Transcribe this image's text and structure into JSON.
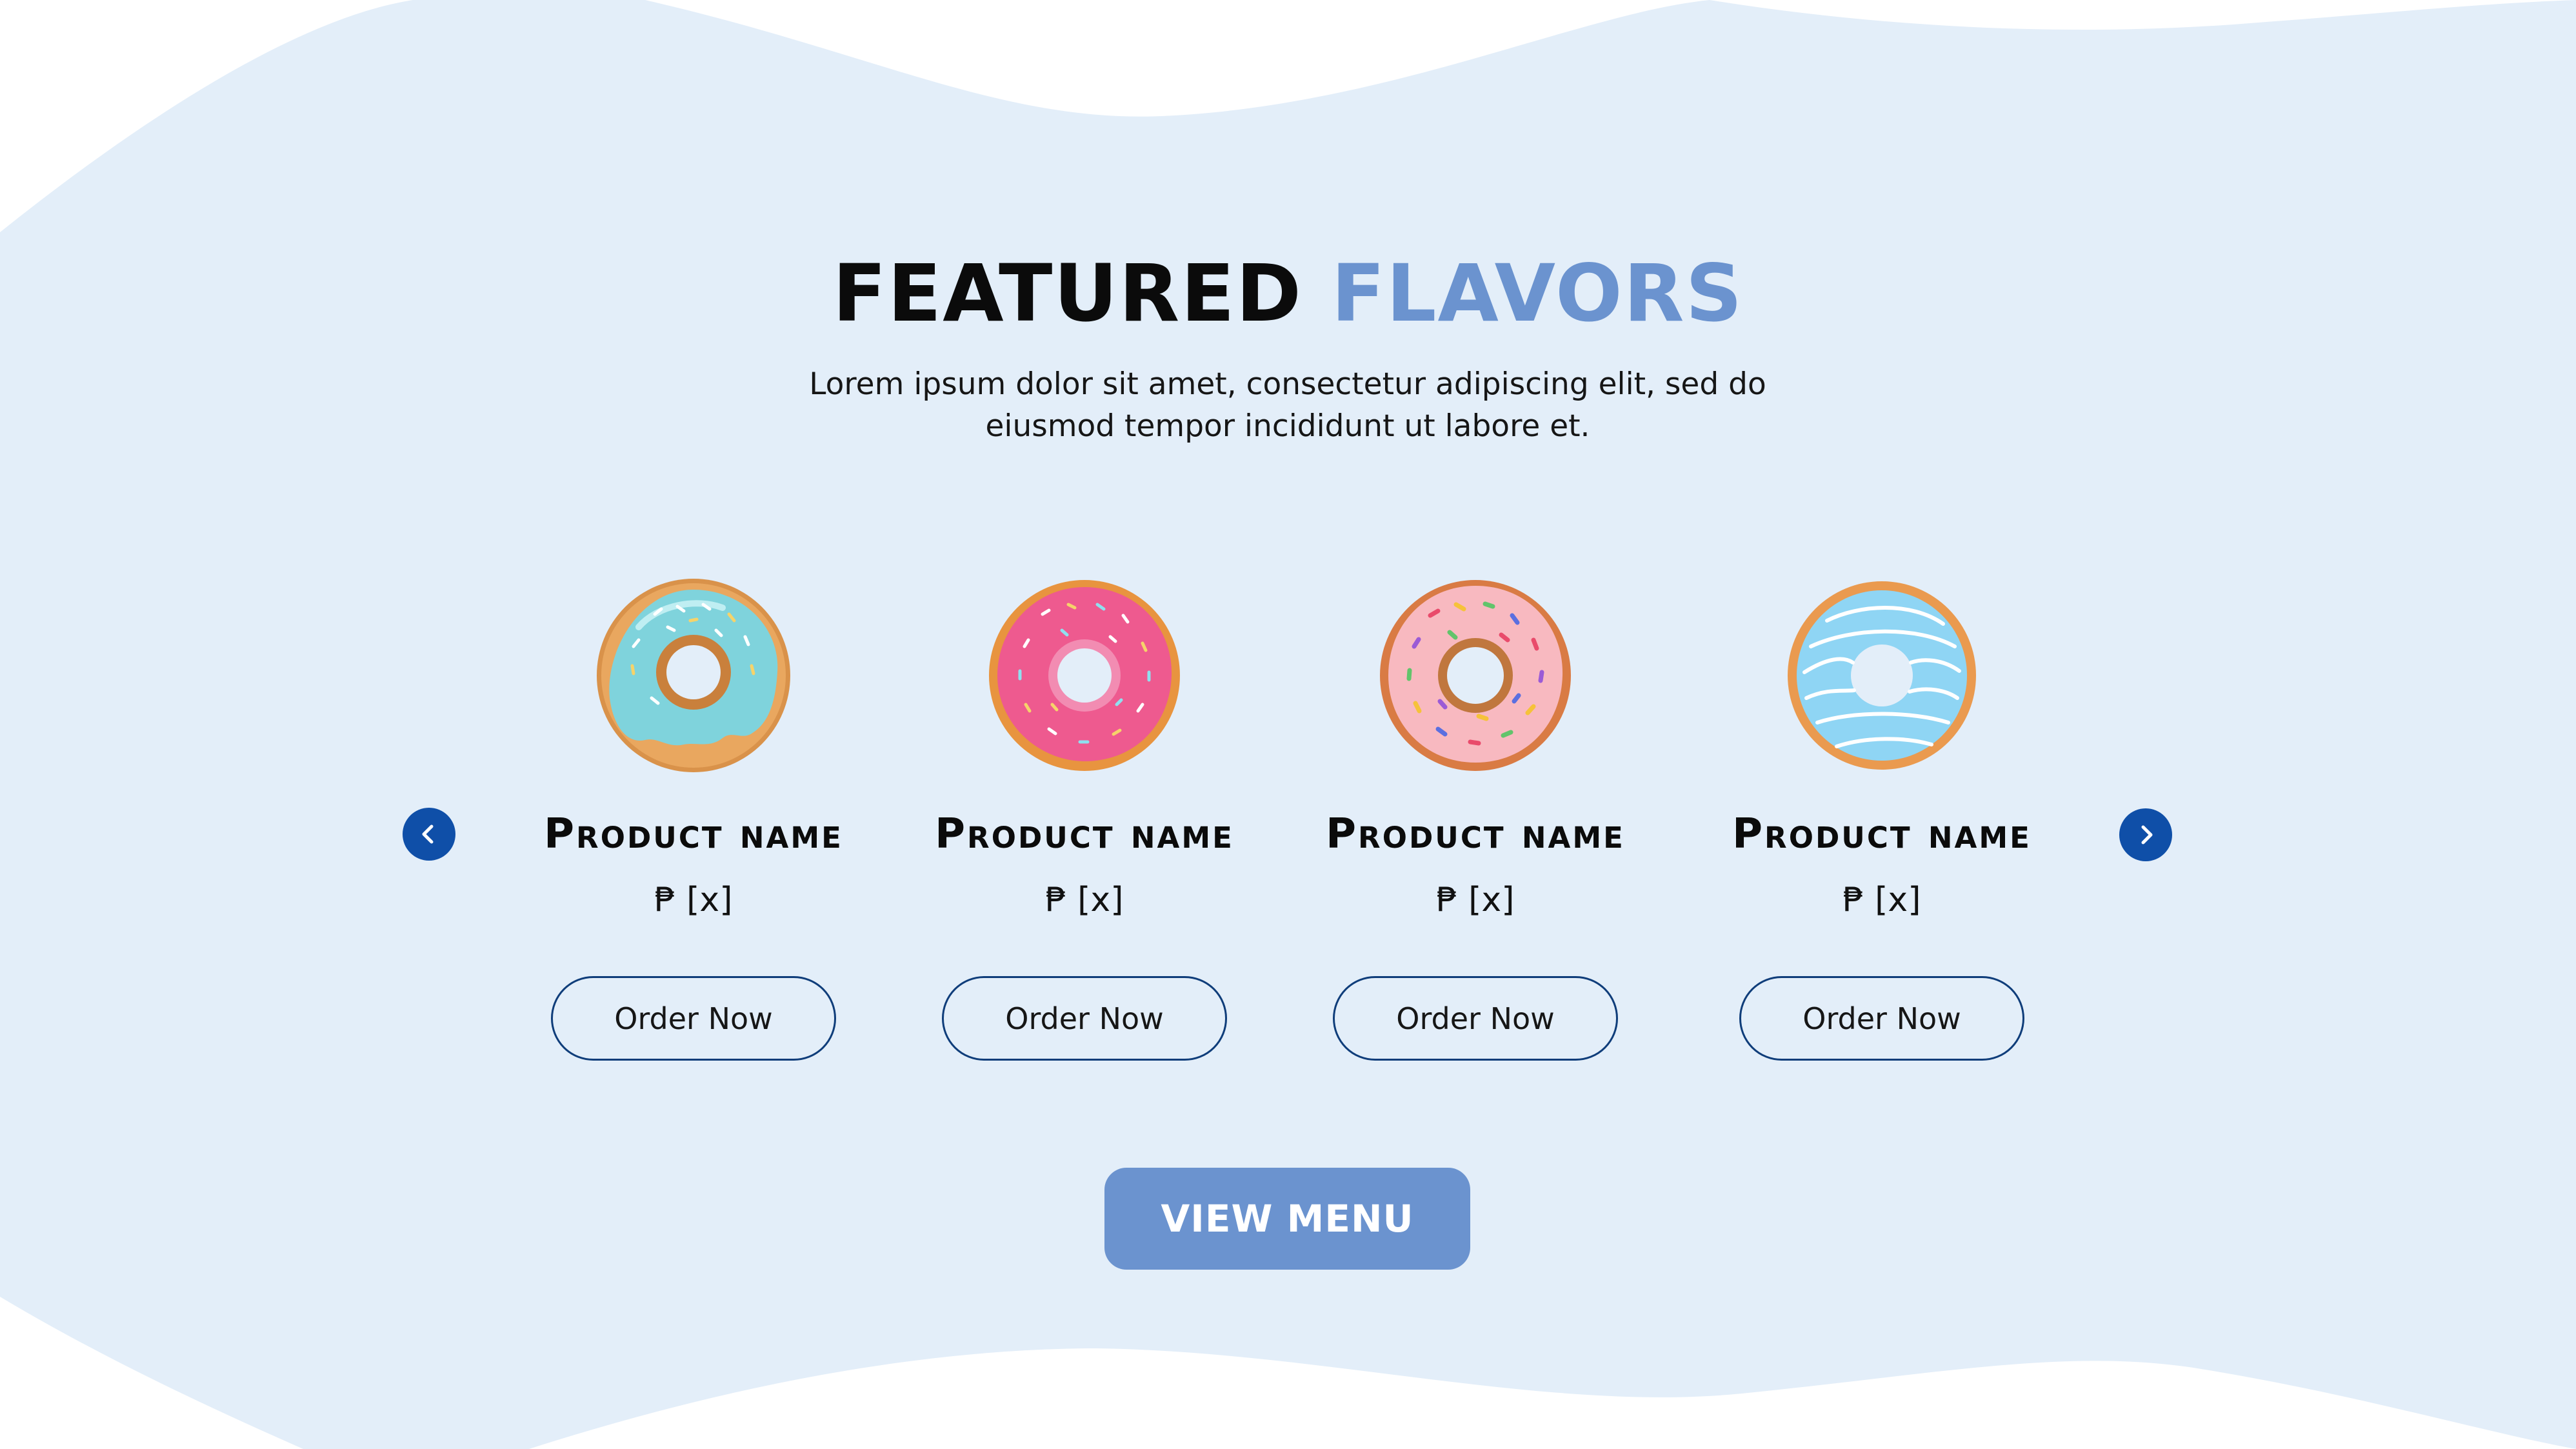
{
  "colors": {
    "background_wave": "#e3eef9",
    "page_background": "#ffffff",
    "accent": "#6b93cf",
    "arrow": "#0f4fa8",
    "button_border": "#0f3d7a"
  },
  "header": {
    "title_part1": "FEATURED",
    "title_part2": "FLAVORS",
    "subtitle_line1": "Lorem ipsum dolor sit amet, consectetur adipiscing elit, sed do",
    "subtitle_line2": "eiusmod tempor incididunt ut labore et."
  },
  "carousel": {
    "prev_icon": "chevron-left-icon",
    "next_icon": "chevron-right-icon",
    "products": [
      {
        "image": "blue-glazed-sprinkle-donut",
        "name": "Product name",
        "price": "₱ [x]",
        "button": "Order Now"
      },
      {
        "image": "pink-glazed-sprinkle-donut",
        "name": "Product name",
        "price": "₱ [x]",
        "button": "Order Now"
      },
      {
        "image": "light-pink-sprinkle-donut",
        "name": "Product name",
        "price": "₱ [x]",
        "button": "Order Now"
      },
      {
        "image": "blue-drizzle-donut",
        "name": "Product name",
        "price": "₱ [x]",
        "button": "Order Now"
      }
    ]
  },
  "cta": {
    "view_menu_label": "VIEW MENU"
  }
}
